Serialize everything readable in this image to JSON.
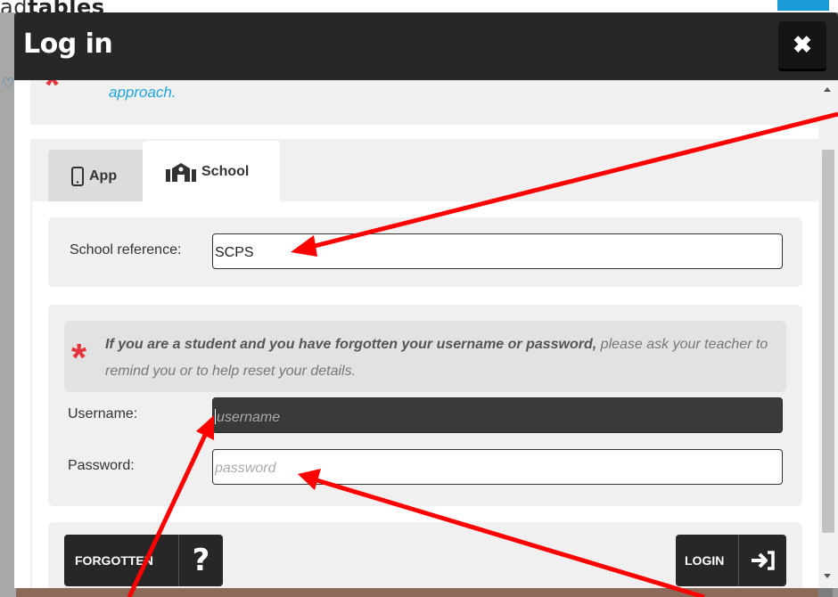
{
  "background": {
    "logo_text": "ad",
    "logo_bold": "tables"
  },
  "modal": {
    "title": "Log in",
    "close_glyph": "✖",
    "intro_fragment": "approach.",
    "tabs": [
      {
        "label": "App",
        "icon": "phone-icon"
      },
      {
        "label": "School",
        "icon": "school-icon"
      }
    ],
    "school_reference": {
      "label": "School reference:",
      "value": "SCPS"
    },
    "info": {
      "bold_text": "If you are a student and you have forgotten your username or password,",
      "rest_text": " please ask your teacher to remind you or to help reset your details."
    },
    "username": {
      "label": "Username:",
      "placeholder": "username"
    },
    "password": {
      "label": "Password:",
      "placeholder": "password"
    },
    "buttons": {
      "forgotten_label": "FORGOTTEN",
      "forgotten_glyph": "?",
      "login_label": "LOGIN"
    }
  },
  "colors": {
    "accent_red": "#e8323c",
    "link_blue": "#21a4dc",
    "header_dark": "#272727",
    "annotation_arrow": "#ff0000"
  }
}
